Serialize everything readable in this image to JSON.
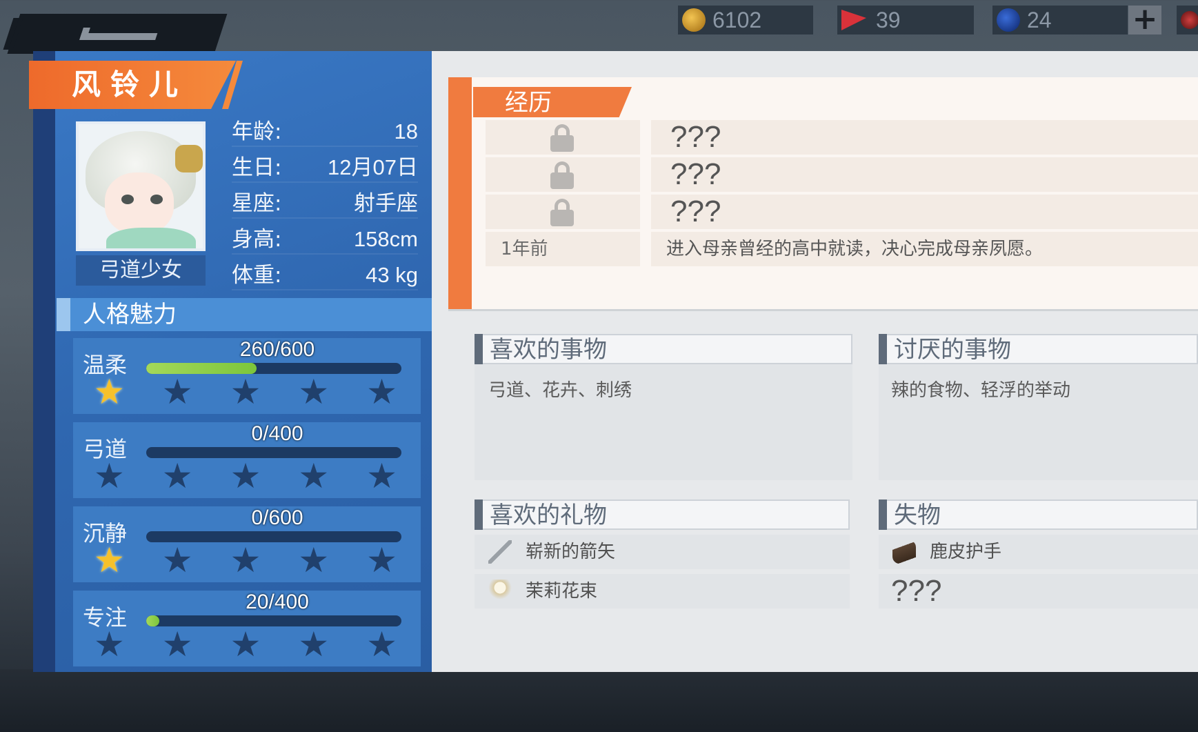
{
  "resources": {
    "coins": "6102",
    "tickets": "39",
    "gems": "24",
    "plus_label": "+"
  },
  "character": {
    "name": "风铃儿",
    "title": "弓道少女",
    "stats": [
      {
        "label": "年龄:",
        "value": "18"
      },
      {
        "label": "生日:",
        "value": "12月07日"
      },
      {
        "label": "星座:",
        "value": "射手座"
      },
      {
        "label": "身高:",
        "value": "158cm"
      },
      {
        "label": "体重:",
        "value": "43 kg"
      }
    ]
  },
  "charm": {
    "heading": "人格魅力",
    "traits": [
      {
        "name": "温柔",
        "value_text": "260/600",
        "progress": 0.433,
        "stars_lit": 1,
        "stars_total": 5
      },
      {
        "name": "弓道",
        "value_text": "0/400",
        "progress": 0.0,
        "stars_lit": 0,
        "stars_total": 5
      },
      {
        "name": "沉静",
        "value_text": "0/600",
        "progress": 0.0,
        "stars_lit": 1,
        "stars_total": 5
      },
      {
        "name": "专注",
        "value_text": "20/400",
        "progress": 0.05,
        "stars_lit": 0,
        "stars_total": 5
      }
    ]
  },
  "history": {
    "heading": "经历",
    "rows": [
      {
        "time": "",
        "locked": true,
        "text": "???"
      },
      {
        "time": "",
        "locked": true,
        "text": "???"
      },
      {
        "time": "",
        "locked": true,
        "text": "???"
      },
      {
        "time": "1年前",
        "locked": false,
        "text": "进入母亲曾经的高中就读，决心完成母亲夙愿。"
      }
    ]
  },
  "likes": {
    "heading": "喜欢的事物",
    "text": "弓道、花卉、刺绣"
  },
  "dislikes": {
    "heading": "讨厌的事物",
    "text": "辣的食物、轻浮的举动"
  },
  "gifts": {
    "heading": "喜欢的礼物",
    "items": [
      {
        "icon": "arrow-icon",
        "label": "崭新的箭矢"
      },
      {
        "icon": "flower-bouquet-icon",
        "label": "茉莉花束"
      }
    ]
  },
  "lost_items": {
    "heading": "失物",
    "items": [
      {
        "icon": "glove-icon",
        "label": "鹿皮护手"
      }
    ],
    "unknown": "???"
  },
  "colors": {
    "accent_orange": "#f07b3f",
    "panel_blue": "#3a79c6",
    "star_gold": "#f6c12b",
    "bar_green": "#7cc63b"
  }
}
